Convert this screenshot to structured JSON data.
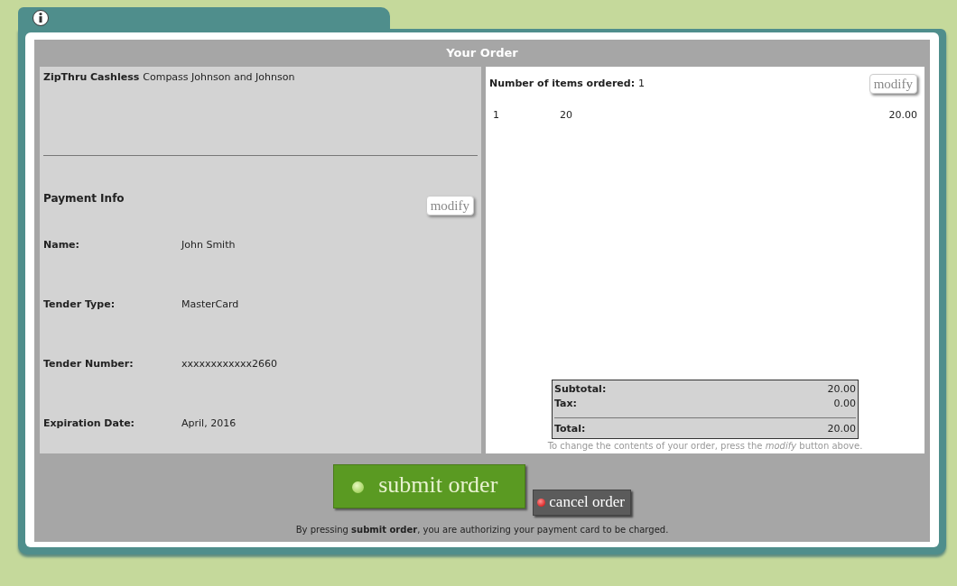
{
  "title": "Your Order",
  "merchant": {
    "name": "ZipThru Cashless",
    "location": "Compass Johnson and Johnson"
  },
  "payment": {
    "heading": "Payment Info",
    "modify": "modify",
    "fields": [
      {
        "label": "Name:",
        "value": "John Smith"
      },
      {
        "label": "Tender Type:",
        "value": "MasterCard"
      },
      {
        "label": "Tender Number:",
        "value": "xxxxxxxxxxxx2660"
      },
      {
        "label": "Expiration Date:",
        "value": "April, 2016"
      }
    ]
  },
  "order": {
    "count_label": "Number of items ordered:",
    "count": "1",
    "modify": "modify",
    "items": [
      {
        "qty": "1",
        "name": "20",
        "price": "20.00"
      }
    ],
    "totals": [
      {
        "label": "Subtotal:",
        "value": "20.00",
        "kind": "line"
      },
      {
        "label": "Tax:",
        "value": "0.00",
        "kind": "line"
      },
      {
        "label": "Total:",
        "value": "20.00",
        "kind": "total"
      }
    ],
    "hint": "To change the contents of your order, press the *modify* button above."
  },
  "submit": "submit order",
  "cancel": "cancel order",
  "notice": "By pressing **submit order**, you are authorizing your payment card to be charged."
}
